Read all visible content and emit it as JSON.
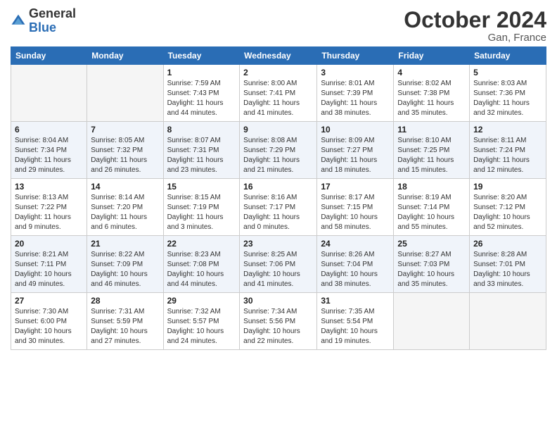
{
  "header": {
    "logo_general": "General",
    "logo_blue": "Blue",
    "month_title": "October 2024",
    "location": "Gan, France"
  },
  "weekdays": [
    "Sunday",
    "Monday",
    "Tuesday",
    "Wednesday",
    "Thursday",
    "Friday",
    "Saturday"
  ],
  "weeks": [
    [
      {
        "day": "",
        "sunrise": "",
        "sunset": "",
        "daylight": "",
        "empty": true
      },
      {
        "day": "",
        "sunrise": "",
        "sunset": "",
        "daylight": "",
        "empty": true
      },
      {
        "day": "1",
        "sunrise": "Sunrise: 7:59 AM",
        "sunset": "Sunset: 7:43 PM",
        "daylight": "Daylight: 11 hours and 44 minutes."
      },
      {
        "day": "2",
        "sunrise": "Sunrise: 8:00 AM",
        "sunset": "Sunset: 7:41 PM",
        "daylight": "Daylight: 11 hours and 41 minutes."
      },
      {
        "day": "3",
        "sunrise": "Sunrise: 8:01 AM",
        "sunset": "Sunset: 7:39 PM",
        "daylight": "Daylight: 11 hours and 38 minutes."
      },
      {
        "day": "4",
        "sunrise": "Sunrise: 8:02 AM",
        "sunset": "Sunset: 7:38 PM",
        "daylight": "Daylight: 11 hours and 35 minutes."
      },
      {
        "day": "5",
        "sunrise": "Sunrise: 8:03 AM",
        "sunset": "Sunset: 7:36 PM",
        "daylight": "Daylight: 11 hours and 32 minutes."
      }
    ],
    [
      {
        "day": "6",
        "sunrise": "Sunrise: 8:04 AM",
        "sunset": "Sunset: 7:34 PM",
        "daylight": "Daylight: 11 hours and 29 minutes."
      },
      {
        "day": "7",
        "sunrise": "Sunrise: 8:05 AM",
        "sunset": "Sunset: 7:32 PM",
        "daylight": "Daylight: 11 hours and 26 minutes."
      },
      {
        "day": "8",
        "sunrise": "Sunrise: 8:07 AM",
        "sunset": "Sunset: 7:31 PM",
        "daylight": "Daylight: 11 hours and 23 minutes."
      },
      {
        "day": "9",
        "sunrise": "Sunrise: 8:08 AM",
        "sunset": "Sunset: 7:29 PM",
        "daylight": "Daylight: 11 hours and 21 minutes."
      },
      {
        "day": "10",
        "sunrise": "Sunrise: 8:09 AM",
        "sunset": "Sunset: 7:27 PM",
        "daylight": "Daylight: 11 hours and 18 minutes."
      },
      {
        "day": "11",
        "sunrise": "Sunrise: 8:10 AM",
        "sunset": "Sunset: 7:25 PM",
        "daylight": "Daylight: 11 hours and 15 minutes."
      },
      {
        "day": "12",
        "sunrise": "Sunrise: 8:11 AM",
        "sunset": "Sunset: 7:24 PM",
        "daylight": "Daylight: 11 hours and 12 minutes."
      }
    ],
    [
      {
        "day": "13",
        "sunrise": "Sunrise: 8:13 AM",
        "sunset": "Sunset: 7:22 PM",
        "daylight": "Daylight: 11 hours and 9 minutes."
      },
      {
        "day": "14",
        "sunrise": "Sunrise: 8:14 AM",
        "sunset": "Sunset: 7:20 PM",
        "daylight": "Daylight: 11 hours and 6 minutes."
      },
      {
        "day": "15",
        "sunrise": "Sunrise: 8:15 AM",
        "sunset": "Sunset: 7:19 PM",
        "daylight": "Daylight: 11 hours and 3 minutes."
      },
      {
        "day": "16",
        "sunrise": "Sunrise: 8:16 AM",
        "sunset": "Sunset: 7:17 PM",
        "daylight": "Daylight: 11 hours and 0 minutes."
      },
      {
        "day": "17",
        "sunrise": "Sunrise: 8:17 AM",
        "sunset": "Sunset: 7:15 PM",
        "daylight": "Daylight: 10 hours and 58 minutes."
      },
      {
        "day": "18",
        "sunrise": "Sunrise: 8:19 AM",
        "sunset": "Sunset: 7:14 PM",
        "daylight": "Daylight: 10 hours and 55 minutes."
      },
      {
        "day": "19",
        "sunrise": "Sunrise: 8:20 AM",
        "sunset": "Sunset: 7:12 PM",
        "daylight": "Daylight: 10 hours and 52 minutes."
      }
    ],
    [
      {
        "day": "20",
        "sunrise": "Sunrise: 8:21 AM",
        "sunset": "Sunset: 7:11 PM",
        "daylight": "Daylight: 10 hours and 49 minutes."
      },
      {
        "day": "21",
        "sunrise": "Sunrise: 8:22 AM",
        "sunset": "Sunset: 7:09 PM",
        "daylight": "Daylight: 10 hours and 46 minutes."
      },
      {
        "day": "22",
        "sunrise": "Sunrise: 8:23 AM",
        "sunset": "Sunset: 7:08 PM",
        "daylight": "Daylight: 10 hours and 44 minutes."
      },
      {
        "day": "23",
        "sunrise": "Sunrise: 8:25 AM",
        "sunset": "Sunset: 7:06 PM",
        "daylight": "Daylight: 10 hours and 41 minutes."
      },
      {
        "day": "24",
        "sunrise": "Sunrise: 8:26 AM",
        "sunset": "Sunset: 7:04 PM",
        "daylight": "Daylight: 10 hours and 38 minutes."
      },
      {
        "day": "25",
        "sunrise": "Sunrise: 8:27 AM",
        "sunset": "Sunset: 7:03 PM",
        "daylight": "Daylight: 10 hours and 35 minutes."
      },
      {
        "day": "26",
        "sunrise": "Sunrise: 8:28 AM",
        "sunset": "Sunset: 7:01 PM",
        "daylight": "Daylight: 10 hours and 33 minutes."
      }
    ],
    [
      {
        "day": "27",
        "sunrise": "Sunrise: 7:30 AM",
        "sunset": "Sunset: 6:00 PM",
        "daylight": "Daylight: 10 hours and 30 minutes."
      },
      {
        "day": "28",
        "sunrise": "Sunrise: 7:31 AM",
        "sunset": "Sunset: 5:59 PM",
        "daylight": "Daylight: 10 hours and 27 minutes."
      },
      {
        "day": "29",
        "sunrise": "Sunrise: 7:32 AM",
        "sunset": "Sunset: 5:57 PM",
        "daylight": "Daylight: 10 hours and 24 minutes."
      },
      {
        "day": "30",
        "sunrise": "Sunrise: 7:34 AM",
        "sunset": "Sunset: 5:56 PM",
        "daylight": "Daylight: 10 hours and 22 minutes."
      },
      {
        "day": "31",
        "sunrise": "Sunrise: 7:35 AM",
        "sunset": "Sunset: 5:54 PM",
        "daylight": "Daylight: 10 hours and 19 minutes."
      },
      {
        "day": "",
        "sunrise": "",
        "sunset": "",
        "daylight": "",
        "empty": true
      },
      {
        "day": "",
        "sunrise": "",
        "sunset": "",
        "daylight": "",
        "empty": true
      }
    ]
  ]
}
